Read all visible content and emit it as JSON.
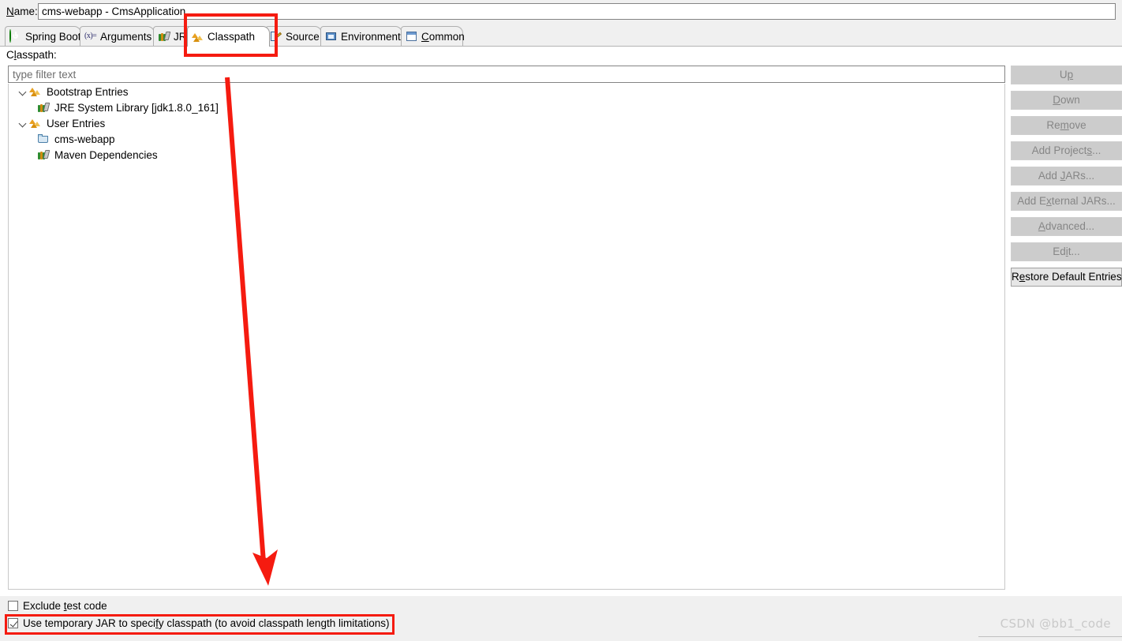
{
  "name_field": {
    "label": "Name:",
    "mnemonic": "N",
    "value": "cms-webapp - CmsApplication"
  },
  "tabs": [
    {
      "label": "Spring Boot",
      "icon": "spring-boot-icon",
      "selected": false,
      "mnemonic": ""
    },
    {
      "label": "Arguments",
      "icon": "arguments-icon",
      "selected": false,
      "mnemonic": ""
    },
    {
      "label": "JRE",
      "icon": "jre-library-icon",
      "selected": false,
      "mnemonic": ""
    },
    {
      "label": "Classpath",
      "icon": "classpath-icon",
      "selected": true,
      "mnemonic": ""
    },
    {
      "label": "Source",
      "icon": "source-icon",
      "selected": false,
      "mnemonic": ""
    },
    {
      "label": "Environment",
      "icon": "environment-icon",
      "selected": false,
      "mnemonic": ""
    },
    {
      "label": "Common",
      "icon": "common-icon",
      "selected": false,
      "mnemonic": "C"
    }
  ],
  "classpath_section": {
    "label": "Classpath:",
    "mnemonic": "l",
    "filter_placeholder": "type filter text",
    "filter_value": ""
  },
  "tree": [
    {
      "label": "Bootstrap Entries",
      "icon": "classpath-icon",
      "indent": 0,
      "expandable": true,
      "expanded": true
    },
    {
      "label": "JRE System Library [jdk1.8.0_161]",
      "icon": "jre-library-icon",
      "indent": 1,
      "expandable": false,
      "expanded": false
    },
    {
      "label": "User Entries",
      "icon": "classpath-icon",
      "indent": 0,
      "expandable": true,
      "expanded": true
    },
    {
      "label": "cms-webapp",
      "icon": "project-folder-icon",
      "indent": 1,
      "expandable": false,
      "expanded": false
    },
    {
      "label": "Maven Dependencies",
      "icon": "jre-library-icon",
      "indent": 1,
      "expandable": false,
      "expanded": false
    }
  ],
  "buttons": [
    {
      "label": "Up",
      "mnemonic": "p",
      "enabled": false
    },
    {
      "label": "Down",
      "mnemonic": "D",
      "enabled": false
    },
    {
      "label": "Remove",
      "mnemonic": "m",
      "enabled": false
    },
    {
      "label": "Add Projects...",
      "mnemonic": "s",
      "enabled": false
    },
    {
      "label": "Add JARs...",
      "mnemonic": "J",
      "enabled": false
    },
    {
      "label": "Add External JARs...",
      "mnemonic": "x",
      "enabled": false
    },
    {
      "label": "Advanced...",
      "mnemonic": "A",
      "enabled": false
    },
    {
      "label": "Edit...",
      "mnemonic": "i",
      "enabled": false
    },
    {
      "label": "Restore Default Entries",
      "mnemonic": "e",
      "enabled": true
    }
  ],
  "checkboxes": [
    {
      "label": "Exclude test code",
      "mnemonic": "t",
      "checked": false
    },
    {
      "label": "Use temporary JAR to specify classpath (to avoid classpath length limitations)",
      "mnemonic": "f",
      "checked": true
    }
  ],
  "annotations": {
    "highlight_color": "#f51b10",
    "tab_box_target": "Classpath",
    "checkbox_box_target": "Use temporary JAR to specify classpath (to avoid classpath length limitations)",
    "arrow_from": "Classpath tab",
    "arrow_to": "Use temporary JAR checkbox"
  },
  "watermark": "CSDN @bb1_code"
}
